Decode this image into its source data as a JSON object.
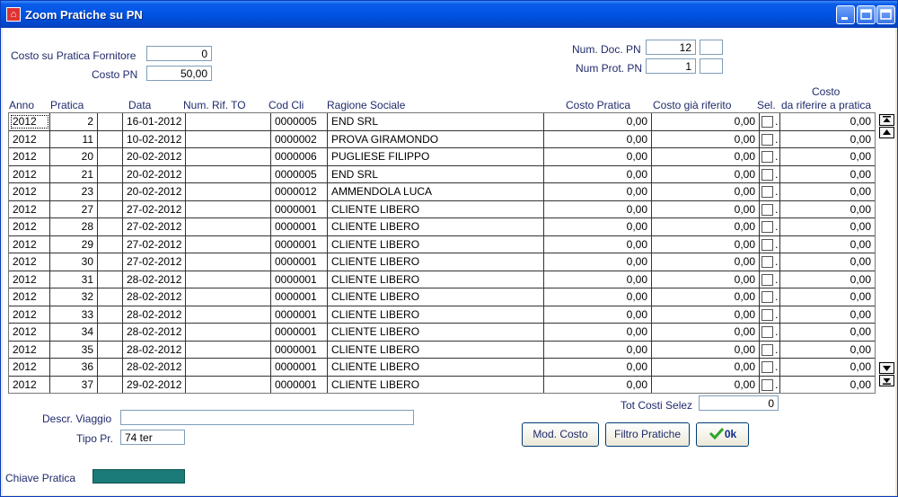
{
  "window": {
    "title": "Zoom Pratiche su PN"
  },
  "header": {
    "costo_su_pratica_label": "Costo su Pratica Fornitore",
    "costo_su_pratica_value": "0",
    "costo_pn_label": "Costo PN",
    "costo_pn_value": "50,00",
    "num_doc_label": "Num. Doc. PN",
    "num_doc_value": "12",
    "num_doc_extra": "",
    "num_prot_label": "Num Prot. PN",
    "num_prot_value": "1",
    "num_prot_extra": ""
  },
  "grid": {
    "columns": {
      "anno": "Anno",
      "pratica": "Pratica",
      "data": "Data",
      "num_rif": "Num. Rif. TO",
      "cod_cli": "Cod Cli",
      "ragione": "Ragione Sociale",
      "costo_pratica": "Costo Pratica",
      "costo_gia": "Costo già riferito",
      "sel": "Sel.",
      "costo_top": "Costo",
      "costo_rif": "da riferire a pratica"
    },
    "rows": [
      {
        "anno": "2012",
        "pratica": "2",
        "data": "16-01-2012",
        "num_rif": "",
        "cod_cli": "0000005",
        "ragione": "END SRL",
        "costo_pratica": "0,00",
        "costo_gia": "0,00",
        "sel_mark": ".",
        "costo_rif": "0,00"
      },
      {
        "anno": "2012",
        "pratica": "11",
        "data": "10-02-2012",
        "num_rif": "",
        "cod_cli": "0000002",
        "ragione": "PROVA GIRAMONDO",
        "costo_pratica": "0,00",
        "costo_gia": "0,00",
        "sel_mark": ".",
        "costo_rif": "0,00"
      },
      {
        "anno": "2012",
        "pratica": "20",
        "data": "20-02-2012",
        "num_rif": "",
        "cod_cli": "0000006",
        "ragione": "PUGLIESE FILIPPO",
        "costo_pratica": "0,00",
        "costo_gia": "0,00",
        "sel_mark": ".",
        "costo_rif": "0,00"
      },
      {
        "anno": "2012",
        "pratica": "21",
        "data": "20-02-2012",
        "num_rif": "",
        "cod_cli": "0000005",
        "ragione": "END SRL",
        "costo_pratica": "0,00",
        "costo_gia": "0,00",
        "sel_mark": ".",
        "costo_rif": "0,00"
      },
      {
        "anno": "2012",
        "pratica": "23",
        "data": "20-02-2012",
        "num_rif": "",
        "cod_cli": "0000012",
        "ragione": "AMMENDOLA LUCA",
        "costo_pratica": "0,00",
        "costo_gia": "0,00",
        "sel_mark": ".",
        "costo_rif": "0,00"
      },
      {
        "anno": "2012",
        "pratica": "27",
        "data": "27-02-2012",
        "num_rif": "",
        "cod_cli": "0000001",
        "ragione": "CLIENTE LIBERO",
        "costo_pratica": "0,00",
        "costo_gia": "0,00",
        "sel_mark": ".",
        "costo_rif": "0,00"
      },
      {
        "anno": "2012",
        "pratica": "28",
        "data": "27-02-2012",
        "num_rif": "",
        "cod_cli": "0000001",
        "ragione": "CLIENTE LIBERO",
        "costo_pratica": "0,00",
        "costo_gia": "0,00",
        "sel_mark": ".",
        "costo_rif": "0,00"
      },
      {
        "anno": "2012",
        "pratica": "29",
        "data": "27-02-2012",
        "num_rif": "",
        "cod_cli": "0000001",
        "ragione": "CLIENTE LIBERO",
        "costo_pratica": "0,00",
        "costo_gia": "0,00",
        "sel_mark": ".",
        "costo_rif": "0,00"
      },
      {
        "anno": "2012",
        "pratica": "30",
        "data": "27-02-2012",
        "num_rif": "",
        "cod_cli": "0000001",
        "ragione": "CLIENTE LIBERO",
        "costo_pratica": "0,00",
        "costo_gia": "0,00",
        "sel_mark": ".",
        "costo_rif": "0,00"
      },
      {
        "anno": "2012",
        "pratica": "31",
        "data": "28-02-2012",
        "num_rif": "",
        "cod_cli": "0000001",
        "ragione": "CLIENTE LIBERO",
        "costo_pratica": "0,00",
        "costo_gia": "0,00",
        "sel_mark": ".",
        "costo_rif": "0,00"
      },
      {
        "anno": "2012",
        "pratica": "32",
        "data": "28-02-2012",
        "num_rif": "",
        "cod_cli": "0000001",
        "ragione": "CLIENTE LIBERO",
        "costo_pratica": "0,00",
        "costo_gia": "0,00",
        "sel_mark": ".",
        "costo_rif": "0,00"
      },
      {
        "anno": "2012",
        "pratica": "33",
        "data": "28-02-2012",
        "num_rif": "",
        "cod_cli": "0000001",
        "ragione": "CLIENTE LIBERO",
        "costo_pratica": "0,00",
        "costo_gia": "0,00",
        "sel_mark": ".",
        "costo_rif": "0,00"
      },
      {
        "anno": "2012",
        "pratica": "34",
        "data": "28-02-2012",
        "num_rif": "",
        "cod_cli": "0000001",
        "ragione": "CLIENTE LIBERO",
        "costo_pratica": "0,00",
        "costo_gia": "0,00",
        "sel_mark": ".",
        "costo_rif": "0,00"
      },
      {
        "anno": "2012",
        "pratica": "35",
        "data": "28-02-2012",
        "num_rif": "",
        "cod_cli": "0000001",
        "ragione": "CLIENTE LIBERO",
        "costo_pratica": "0,00",
        "costo_gia": "0,00",
        "sel_mark": ".",
        "costo_rif": "0,00"
      },
      {
        "anno": "2012",
        "pratica": "36",
        "data": "28-02-2012",
        "num_rif": "",
        "cod_cli": "0000001",
        "ragione": "CLIENTE LIBERO",
        "costo_pratica": "0,00",
        "costo_gia": "0,00",
        "sel_mark": ".",
        "costo_rif": "0,00"
      },
      {
        "anno": "2012",
        "pratica": "37",
        "data": "29-02-2012",
        "num_rif": "",
        "cod_cli": "0000001",
        "ragione": "CLIENTE LIBERO",
        "costo_pratica": "0,00",
        "costo_gia": "0,00",
        "sel_mark": ".",
        "costo_rif": "0,00"
      }
    ]
  },
  "footer": {
    "tot_label": "Tot Costi Selez",
    "tot_value": "0",
    "descr_label": "Descr. Viaggio",
    "descr_value": "",
    "tipo_label": "Tipo Pr.",
    "tipo_value": "74 ter",
    "mod_costo": "Mod. Costo",
    "filtro": "Filtro Pratiche",
    "ok": "0k",
    "chiave_label": "Chiave Pratica"
  },
  "colors": {
    "title_bar": "#0054e3",
    "key_bar": "#1a7b78",
    "label_text": "#1f2a6b"
  }
}
